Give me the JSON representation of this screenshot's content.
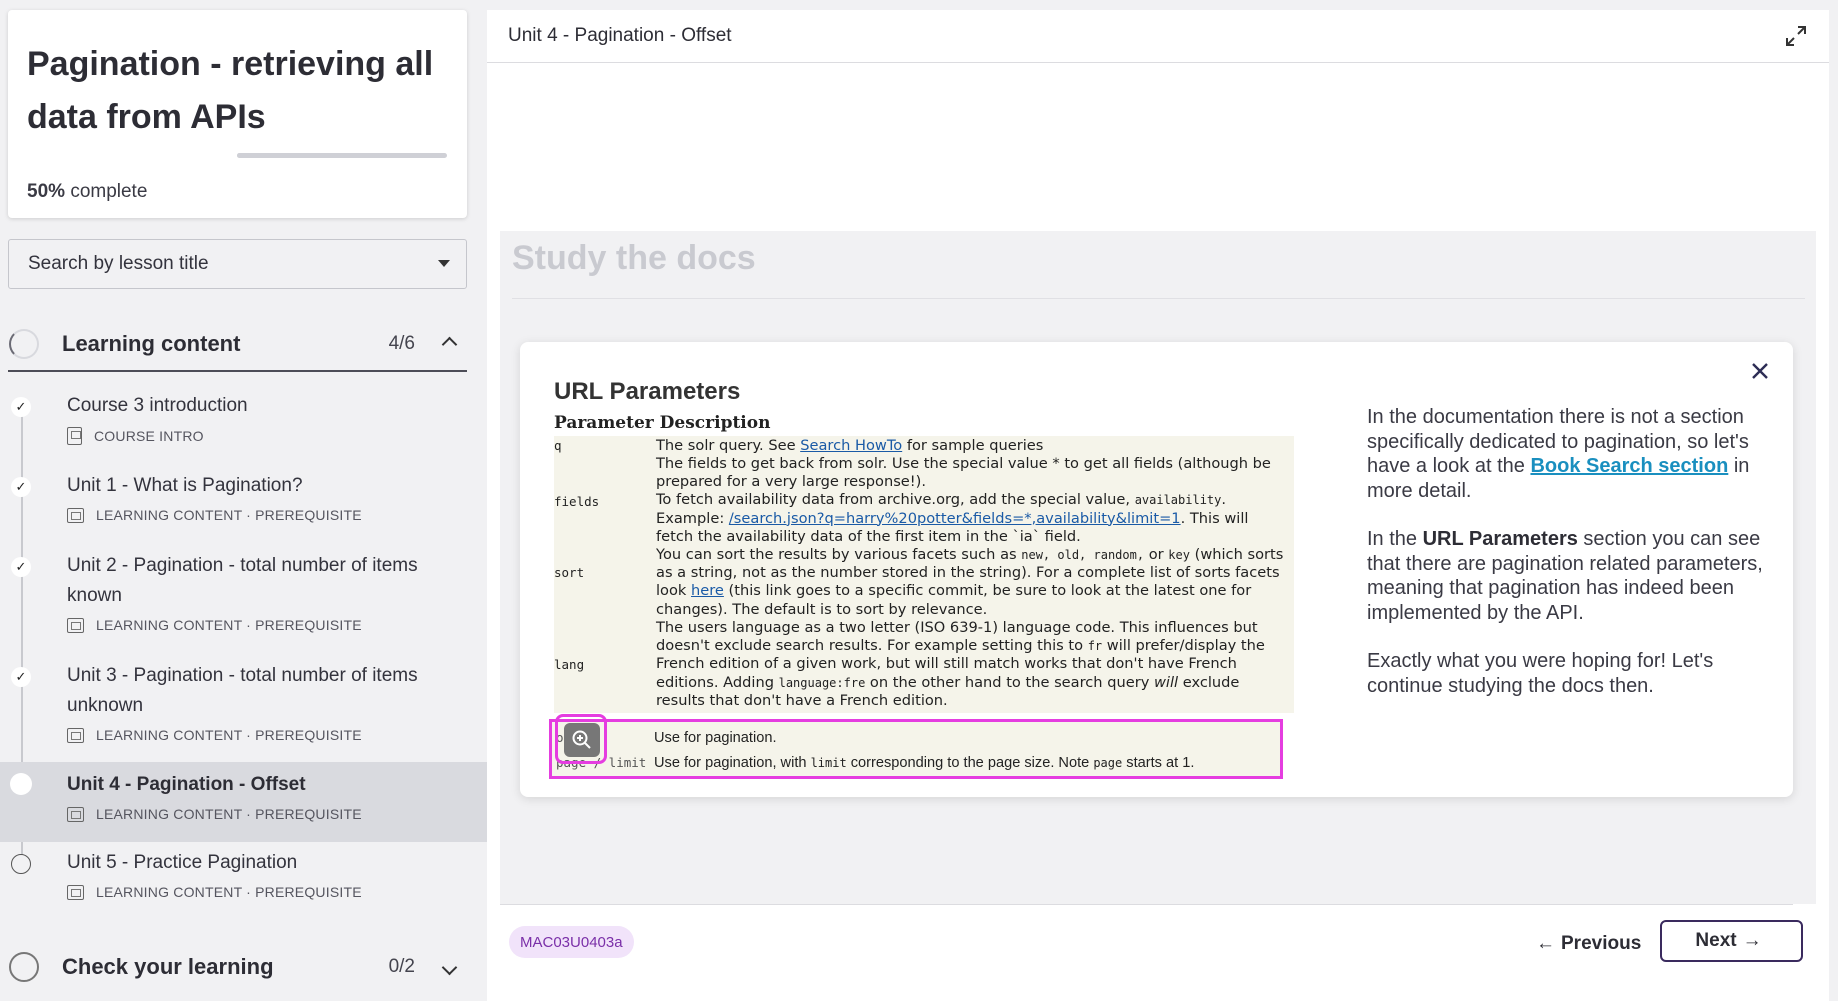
{
  "course": {
    "title": "Pagination - retrieving all data from APIs",
    "progress_percent": 50,
    "progress_value": "50%",
    "progress_suffix": "complete"
  },
  "search": {
    "placeholder": "Search by lesson title"
  },
  "sections": [
    {
      "label": "Learning content",
      "count": "4/6",
      "expanded": true
    },
    {
      "label": "Check your learning",
      "count": "0/2",
      "expanded": false
    }
  ],
  "lessons": [
    {
      "title": "Course 3 introduction",
      "meta": "COURSE INTRO",
      "status": "done"
    },
    {
      "title": "Unit 1 - What is Pagination?",
      "meta": "LEARNING CONTENT · PREREQUISITE",
      "status": "done"
    },
    {
      "title": "Unit 2 - Pagination - total number of items known",
      "meta": "LEARNING CONTENT · PREREQUISITE",
      "status": "done"
    },
    {
      "title": "Unit 3 - Pagination - total number of items unknown",
      "meta": "LEARNING CONTENT · PREREQUISITE",
      "status": "done"
    },
    {
      "title": "Unit 4 - Pagination - Offset",
      "meta": "LEARNING CONTENT · PREREQUISITE",
      "status": "current"
    },
    {
      "title": "Unit 5 - Practice Pagination",
      "meta": "LEARNING CONTENT · PREREQUISITE",
      "status": "todo"
    }
  ],
  "main": {
    "header_title": "Unit 4 - Pagination - Offset",
    "study_title": "Study the docs",
    "code_badge": "MAC03U0403a",
    "prev_label": "Previous",
    "next_label": "Next"
  },
  "modal": {
    "doc_heading": "URL Parameters",
    "col_param": "Parameter",
    "col_desc": "Description",
    "rows": {
      "q_key": "q",
      "q_a": "The solr query. See ",
      "q_link": "Search HowTo",
      "q_b": " for sample queries",
      "fields_key": "fields",
      "fields_1": "The fields to get back from solr. Use the special value * to get all fields (although be",
      "fields_2": "prepared for a very large response!).",
      "fields_3": "To fetch availability data from archive.org, add the special value, ",
      "fields_3m": "availability",
      "fields_4a": "Example: ",
      "fields_4link": "/search.json?q=harry%20potter&fields=*,availability&limit=1",
      "fields_4b": ". This will",
      "fields_5": "fetch the availability data of the first item in the `ia` field.",
      "sort_key": "sort",
      "sort_1a": "You can sort the results by various facets such as ",
      "sort_1m": "new, old, random,",
      "sort_1b": " or ",
      "sort_1m2": "key",
      "sort_1c": " (which sorts",
      "sort_2": "as a string, not as the number stored in the string). For a complete list of sorts facets",
      "sort_3a": "look ",
      "sort_3link": "here",
      "sort_3b": " (this link goes to a specific commit, be sure to look at the latest one for",
      "sort_4": "changes). The default is to sort by relevance.",
      "lang_key": "lang",
      "lang_1": "The users language as a two letter (ISO 639-1) language code. This influences but",
      "lang_2a": "doesn't exclude search results. For example setting this to ",
      "lang_2m": "fr",
      "lang_2b": " will prefer/display the",
      "lang_3": "French edition of a given work, but will still match works that don't have French",
      "lang_4a": "editions. Adding ",
      "lang_4m": "language:fre",
      "lang_4b": " on the other hand to the search query ",
      "lang_4i": "will",
      "lang_4c": " exclude",
      "lang_5": "results that don't have a French edition.",
      "offset_key": "offset",
      "offset_desc": "Use for pagination.",
      "page_key": "page / limit",
      "page_a": "Use for pagination, with ",
      "page_m": "limit",
      "page_b": " corresponding to the page size. Note ",
      "page_m2": "page",
      "page_c": " starts at 1."
    },
    "explain": {
      "p1a": "In the documentation there is not a section specifically dedicated to pagination, so let's have a look at the ",
      "p1link": "Book Search section",
      "p1b": " in more detail.",
      "p2a": "In the ",
      "p2b": "URL Parameters",
      "p2c": " section you can see that there are pagination related parameters, meaning that pagination has indeed been implemented by the API.",
      "p3": "Exactly what you were hoping for! Let's continue studying the docs then."
    }
  },
  "colors": {
    "accent_highlight": "#e53de0",
    "link": "#1a8fbf",
    "badge_bg": "#f1e3fa",
    "badge_text": "#7a2fa8"
  },
  "icons": {
    "expand": "expand-icon",
    "close": "close-icon",
    "zoom": "zoom-in-icon",
    "check": "check-icon"
  }
}
